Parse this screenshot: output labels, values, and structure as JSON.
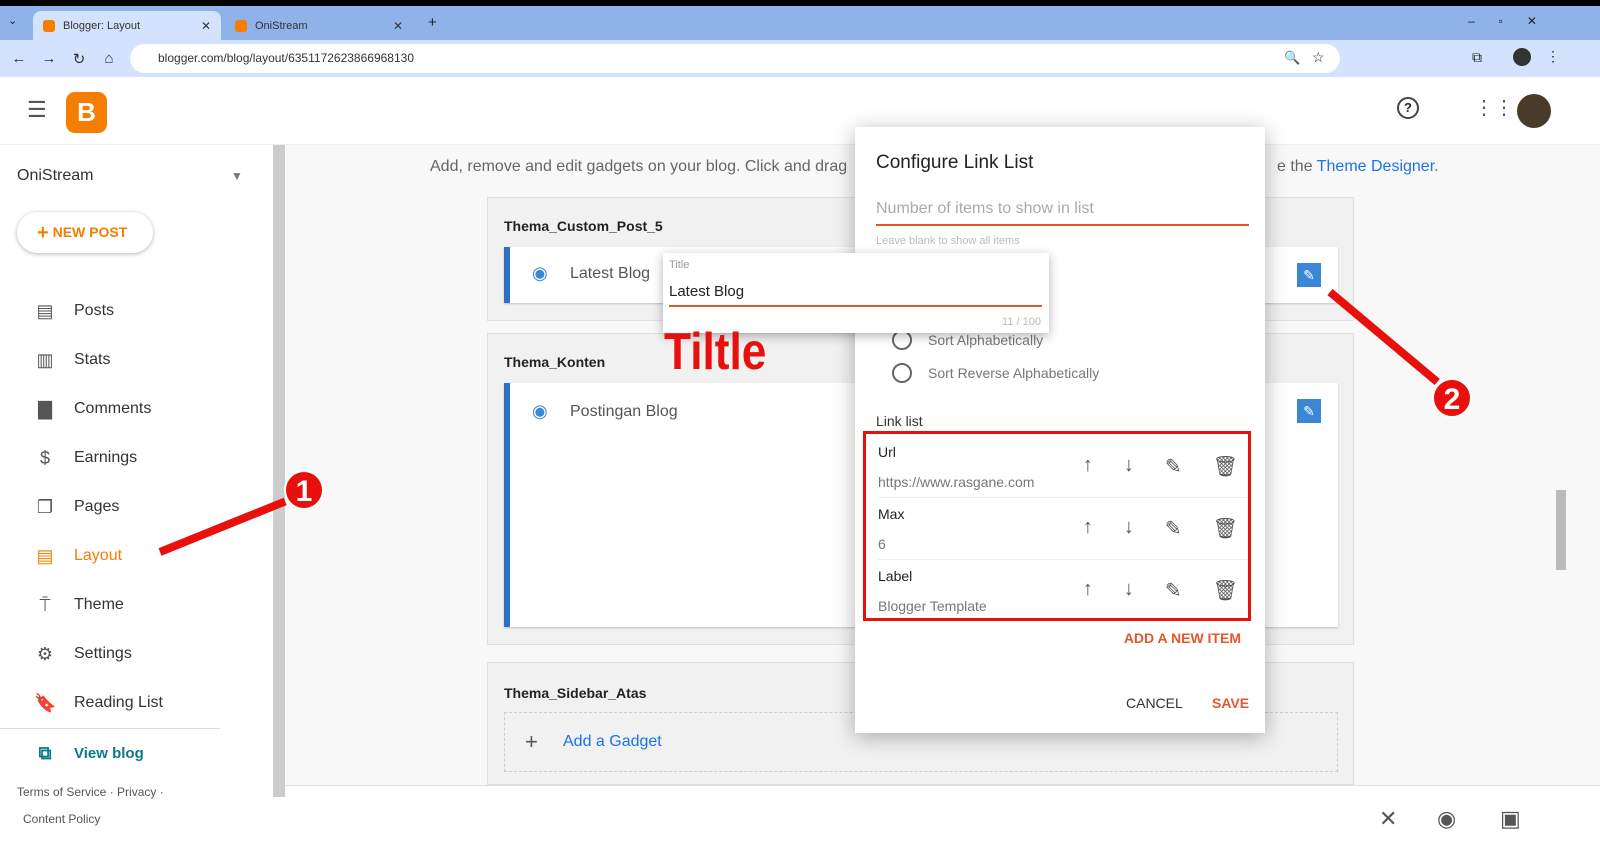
{
  "browser": {
    "tabs": [
      {
        "label": "Blogger: Layout",
        "active": true
      },
      {
        "label": "OniStream",
        "active": false
      }
    ],
    "url": "blogger.com/blog/layout/6351172623866968130"
  },
  "sidebar": {
    "blog_name": "OniStream",
    "new_post": "NEW POST",
    "items": [
      {
        "label": "Posts",
        "icon": "posts-icon"
      },
      {
        "label": "Stats",
        "icon": "stats-icon"
      },
      {
        "label": "Comments",
        "icon": "comments-icon"
      },
      {
        "label": "Earnings",
        "icon": "dollar-icon"
      },
      {
        "label": "Pages",
        "icon": "pages-icon"
      },
      {
        "label": "Layout",
        "icon": "layout-icon",
        "active": true
      },
      {
        "label": "Theme",
        "icon": "paint-roller-icon"
      },
      {
        "label": "Settings",
        "icon": "gear-icon"
      },
      {
        "label": "Reading List",
        "icon": "bookmark-icon"
      }
    ],
    "view_blog": "View blog",
    "footer": {
      "terms": "Terms of Service",
      "privacy": "Privacy",
      "content_policy": "Content Policy"
    }
  },
  "main": {
    "intro": "Add, remove and edit gadgets on your blog. Click and drag",
    "intro_end": "e the",
    "theme_designer": "Theme Designer",
    "intro_dot": ".",
    "sections": [
      {
        "title": "Thema_Custom_Post_5",
        "gadget": "Latest Blog"
      },
      {
        "title": "Thema_Konten",
        "gadget": "Postingan Blog"
      },
      {
        "title": "Thema_Sidebar_Atas",
        "add": "Add a Gadget"
      }
    ]
  },
  "title_popup": {
    "label": "Title",
    "value": "Latest Blog",
    "counter": "11 / 100"
  },
  "dialog": {
    "title": "Configure Link List",
    "number_placeholder": "Number of items to show in list",
    "number_hint": "Leave blank to show all items",
    "sort_options": [
      "Sort Alphabetically",
      "Sort Reverse Alphabetically"
    ],
    "link_list_label": "Link list",
    "items": [
      {
        "label": "Url",
        "value": "https://www.rasgane.com"
      },
      {
        "label": "Max",
        "value": "6"
      },
      {
        "label": "Label",
        "value": "Blogger Template"
      }
    ],
    "add_item": "ADD A NEW ITEM",
    "cancel": "CANCEL",
    "save": "SAVE"
  },
  "annotations": {
    "tiltle": "Tiltle",
    "badge1": "1",
    "badge2": "2"
  },
  "colors": {
    "accent": "#f57d00",
    "link": "#1a73e8",
    "highlight": "#e8100d",
    "gadget_bar": "#2f6fc4"
  }
}
